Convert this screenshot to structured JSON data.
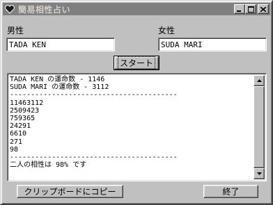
{
  "window": {
    "title": "簡易相性占い",
    "colors": {
      "face": "#c0c0c0",
      "titlebar_inactive": "#808080"
    }
  },
  "form": {
    "male_label": "男性",
    "male_value": "TADA KEN",
    "female_label": "女性",
    "female_value": "SUDA MARI",
    "start_button": "スタート"
  },
  "output": {
    "lines": [
      "TADA KEN の運命数 - 1146",
      "SUDA MARI の運命数 - 3112",
      "----------------------------------------",
      "11463112",
      "2509423",
      "759365",
      "24291",
      "6610",
      "271",
      "98",
      "----------------------------------------",
      "二人の相性は 98% です"
    ]
  },
  "footer": {
    "copy_button": "クリップボードにコピー",
    "exit_button": "終了"
  },
  "icons": {
    "app": "heart-icon",
    "minimize": "minimize-icon",
    "maximize": "maximize-icon",
    "close": "close-icon",
    "scroll_up": "scroll-up-arrow-icon",
    "scroll_down": "scroll-down-arrow-icon"
  }
}
